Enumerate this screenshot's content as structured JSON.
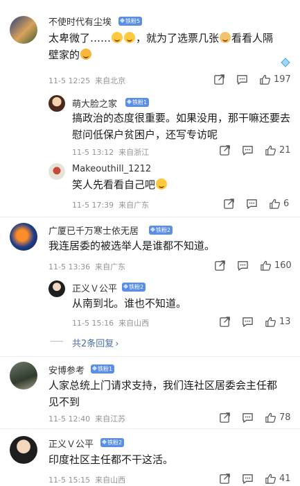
{
  "comments": [
    {
      "user": "不使时代有尘埃",
      "badge": "铁粉5",
      "text_a": "太卑微了……",
      "text_b": "，就为了选票几张",
      "text_c": "看看人隔",
      "text_d": "壁家的",
      "date": "11-5 12:25",
      "loc": "来自北京",
      "likes": "197"
    },
    {
      "user": "萌大脸之家",
      "badge": "铁粉1",
      "text": "搞政治的态度很重要。如果没用，那干嘛还要去慰问低保户贫困户，还写专访呢",
      "date": "11-5 13:12",
      "loc": "来自浙江",
      "likes": "21"
    },
    {
      "user": "Makeouthill_1212",
      "text": "笑人先看看自己吧",
      "date": "11-5 17:39",
      "loc": "来自广东",
      "likes": "6"
    },
    {
      "user": "广厦已千万寒士依无居",
      "badge": "铁粉2",
      "text": "我连居委的被选举人是谁都不知道。",
      "date": "11-5 13:36",
      "loc": "来自广东",
      "likes": "160"
    },
    {
      "user": "正义Ｖ公平",
      "badge": "铁粉2",
      "text": "从南到北。谁也不知道。",
      "date": "11-5 15:16",
      "loc": "来自山西",
      "likes": "13"
    },
    {
      "user": "安博参考",
      "badge": "铁粉1",
      "text": "人家总统上门请求支持，我们连社区居委会主任都见不到",
      "date": "11-5 12:40",
      "loc": "来自江苏",
      "likes": "78"
    },
    {
      "user": "正义Ｖ公平",
      "badge": "铁粉2",
      "text": "印度社区主任都不干这活。",
      "date": "11-5 15:15",
      "loc": "来自山西",
      "likes": "41"
    }
  ],
  "replies_more": "共2条回复",
  "icons": [
    "share-icon",
    "comment-icon",
    "like-icon",
    "diamond-icon",
    "chevron-right-icon"
  ]
}
